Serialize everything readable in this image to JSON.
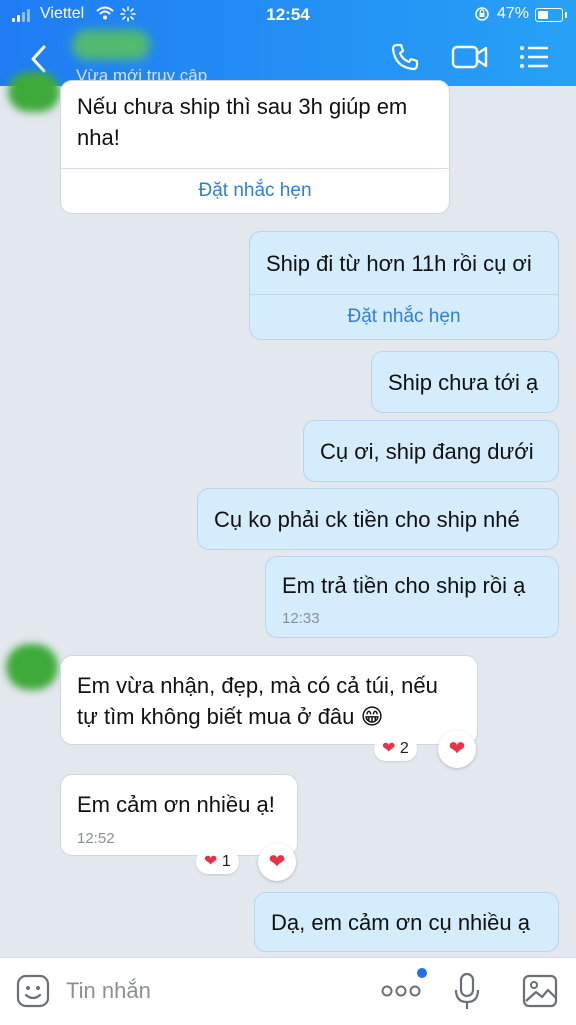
{
  "status_bar": {
    "carrier": "Viettel",
    "time": "12:54",
    "battery": "47%"
  },
  "header": {
    "subtitle": "Vừa mới truy cập"
  },
  "messages": [
    {
      "text1": "Nếu chưa ship thì sau 3h giúp em",
      "text2": "nha!",
      "action": "Đặt nhắc hẹn"
    },
    {
      "text1": "Ship đi từ hơn 11h rồi cụ ơi",
      "action": "Đặt nhắc hẹn"
    },
    {
      "text1": "Ship chưa tới ạ"
    },
    {
      "text1": "Cụ ơi, ship đang dưới"
    },
    {
      "text1": "Cụ ko phải ck tiền cho ship nhé"
    },
    {
      "text1": "Em trả tiền cho ship rồi ạ",
      "time": "12:33"
    },
    {
      "text1": "Em vừa nhận, đẹp, mà có cả túi, nếu",
      "text2": "tự tìm không biết mua ở đâu 😁",
      "reaction": "2"
    },
    {
      "text1": "Em cảm ơn nhiều ạ!",
      "time": "12:52",
      "reaction": "1"
    },
    {
      "text1": "Dạ, em cảm ơn cụ nhiều ạ"
    }
  ],
  "input": {
    "placeholder": "Tin nhắn"
  },
  "icons": {
    "heart": "❤"
  }
}
